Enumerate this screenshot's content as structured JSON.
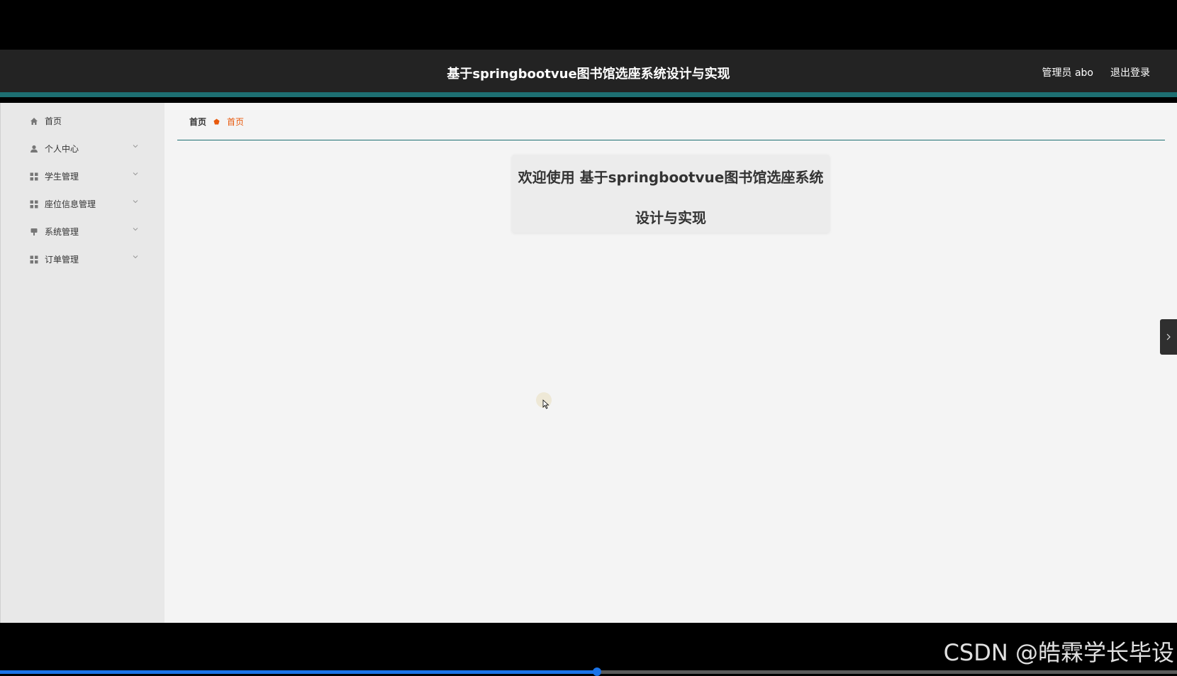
{
  "header": {
    "title": "基于springbootvue图书馆选座系统设计与实现",
    "user_label": "管理员 abo",
    "logout_label": "退出登录"
  },
  "sidebar": {
    "items": [
      {
        "label": "首页",
        "icon": "home-icon"
      },
      {
        "label": "个人中心",
        "icon": "user-icon"
      },
      {
        "label": "学生管理",
        "icon": "grid-icon"
      },
      {
        "label": "座位信息管理",
        "icon": "grid-icon"
      },
      {
        "label": "系统管理",
        "icon": "pin-icon"
      },
      {
        "label": "订单管理",
        "icon": "grid-icon"
      }
    ]
  },
  "breadcrumb": {
    "home": "首页",
    "current": "首页"
  },
  "welcome": {
    "line1": "欢迎使用 基于springbootvue图书馆选座系统",
    "line2": "设计与实现"
  },
  "video": {
    "progress": 0.507
  },
  "watermark": "CSDN @皓霖学长毕设",
  "colors": {
    "header_bg": "#232323",
    "accent": "#1d6f72",
    "breadcrumb_current": "#e8590c"
  }
}
